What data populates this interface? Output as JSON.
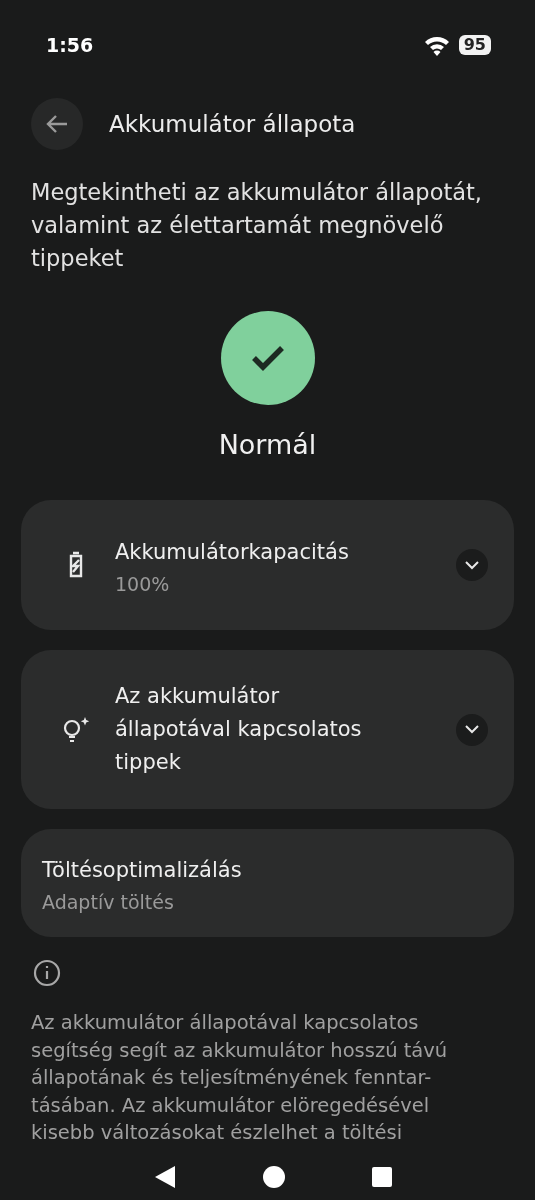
{
  "status_bar": {
    "time": "1:56",
    "battery": "95"
  },
  "header": {
    "title": "Akkumulátor állapota"
  },
  "description": "Megtekintheti az akkumulátor állapotát, valamint az élettartamát megnövelő tippeket",
  "status": {
    "kind": "ok",
    "label": "Normál"
  },
  "cards": [
    {
      "kind": "expandable",
      "title": "Akkumulátorkapacitás",
      "subtitle": "100%",
      "expanded": false
    },
    {
      "kind": "expandable",
      "title": "Az akkumulátor állapotával kapcsolatos tippek",
      "expanded": false
    },
    {
      "kind": "plain",
      "title": "Töltésoptimalizálás",
      "subtitle": "Adaptív töltés"
    }
  ],
  "footer": {
    "lines": [
      "Az akkumulátor állapotával kapcsolatos",
      "segítség segít az akkumulátor hosszú távú",
      "állapotának és teljesítményének fenntar-",
      "tásában. Az akkumulátor elöregedésével",
      "kisebb változásokat észlelhet a töltési"
    ]
  }
}
